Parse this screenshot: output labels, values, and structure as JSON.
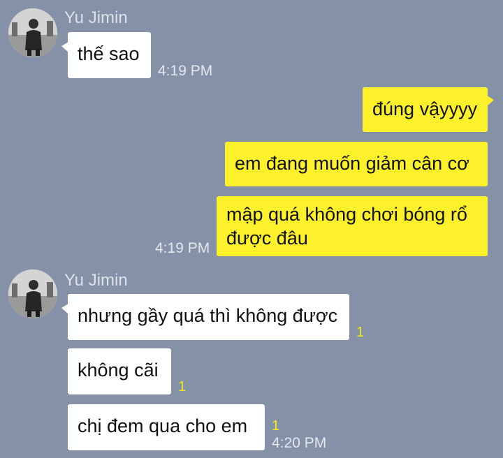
{
  "chat": {
    "groups": [
      {
        "sender": "Yu Jimin",
        "messages": [
          {
            "text": "thế sao",
            "time": "4:19 PM"
          }
        ]
      },
      {
        "sender": "me",
        "messages": [
          {
            "text": "đúng vậyyyy"
          },
          {
            "text": "em đang muốn giảm cân cơ"
          },
          {
            "text": "mập quá không chơi bóng rổ được đâu",
            "time": "4:19 PM"
          }
        ]
      },
      {
        "sender": "Yu Jimin",
        "messages": [
          {
            "text": "nhưng gầy quá thì không được",
            "unread": "1"
          },
          {
            "text": "không cãi",
            "unread": "1"
          },
          {
            "text": "chị đem qua cho em",
            "unread": "1",
            "time": "4:20 PM"
          }
        ]
      }
    ]
  },
  "colors": {
    "background": "#8591a6",
    "incoming_bubble": "#ffffff",
    "outgoing_bubble": "#fcf12a",
    "unread_count": "#f4ea16"
  },
  "icons": {
    "avatar": "profile-photo-icon"
  }
}
